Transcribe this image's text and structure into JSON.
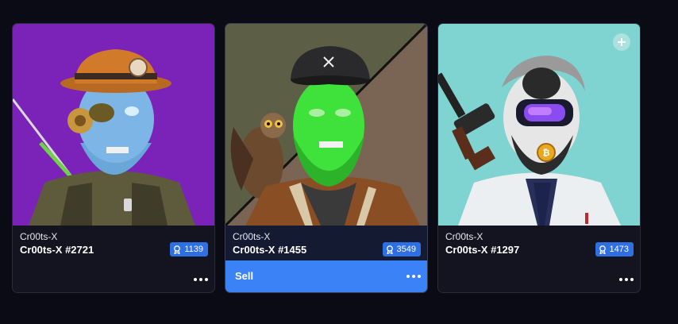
{
  "cards": [
    {
      "collection": "Cr00ts-X",
      "name": "Cr00ts-X #2721",
      "rank": "1139",
      "background": "#7b22b8",
      "selected": false
    },
    {
      "collection": "Cr00ts-X",
      "name": "Cr00ts-X #1455",
      "rank": "3549",
      "background": "#5a5e4a",
      "selected": true,
      "action_label": "Sell"
    },
    {
      "collection": "Cr00ts-X",
      "name": "Cr00ts-X #1297",
      "rank": "1473",
      "background": "#7fd3d0",
      "selected": false
    }
  ],
  "icons": {
    "rank": "award-icon",
    "more": "more-horizontal-icon",
    "add": "plus-circle-icon"
  },
  "colors": {
    "page_bg": "#0a0b14",
    "card_bg": "#13141f",
    "badge": "#2f6fe4",
    "sell": "#3b82f6"
  }
}
